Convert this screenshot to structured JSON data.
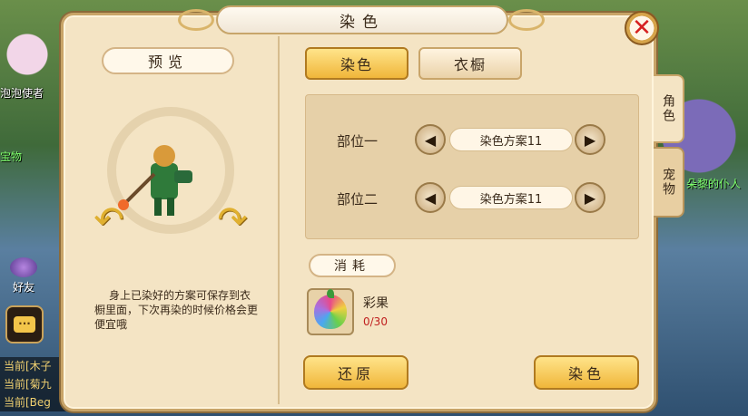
{
  "background": {
    "npc_name": "泡泡使者",
    "npc_sub": "宝物",
    "friend_label": "好友",
    "chat_icon": "chat-bubble-icon",
    "chat_lines": [
      "当前[木子",
      "当前[菊九",
      "当前[Beg"
    ],
    "right_label": "朵黎的仆人"
  },
  "dialog": {
    "title": "染色",
    "close_icon": "close-x-icon"
  },
  "preview": {
    "label": "预览",
    "rotate_left_icon": "rotate-left-arrow-icon",
    "rotate_right_icon": "rotate-right-arrow-icon",
    "description": "身上已染好的方案可保存到衣橱里面，下次再染的时候价格会更便宜哦"
  },
  "tabs": {
    "dye": "染色",
    "wardrobe": "衣橱"
  },
  "slots": [
    {
      "label": "部位一",
      "scheme": "染色方案11"
    },
    {
      "label": "部位二",
      "scheme": "染色方案11"
    }
  ],
  "consume": {
    "label": "消耗",
    "item_name": "彩果",
    "item_count": "0/30"
  },
  "buttons": {
    "restore": "还原",
    "dye": "染色"
  },
  "side_tabs": {
    "role": "角色",
    "pet": "宠物"
  },
  "colors": {
    "panel_bg": "#f4e4c4",
    "button_gold": "#f0b63a",
    "count_red": "#c02020"
  }
}
